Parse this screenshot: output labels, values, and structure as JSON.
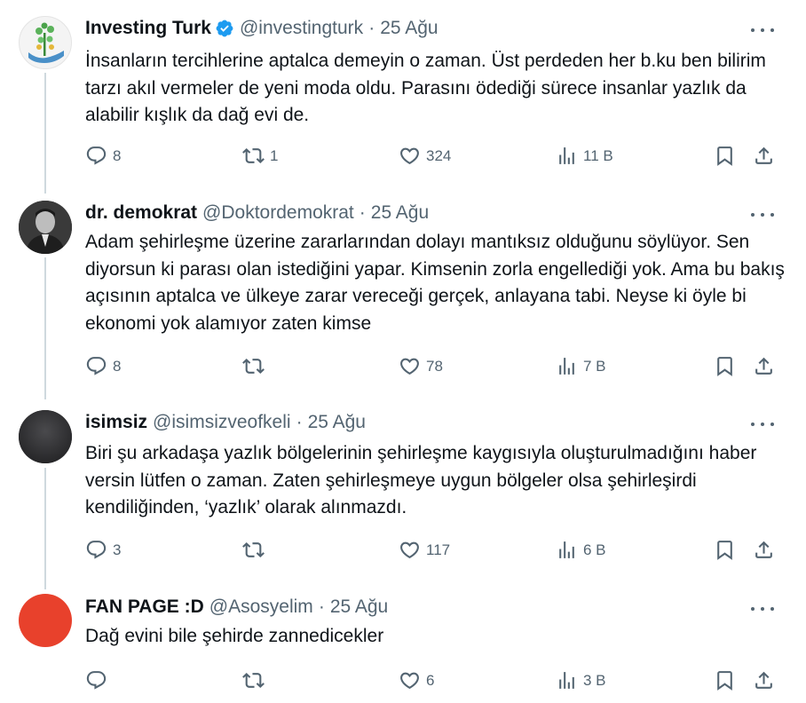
{
  "tweets": [
    {
      "name": "Investing Turk",
      "handle": "@investingturk",
      "date": "25 Ağu",
      "verified": true,
      "text": "İnsanların tercihlerine aptalca demeyin o zaman. Üst perdeden her b.ku ben bilirim tarzı akıl vermeler de yeni moda oldu. Parasını ödediği sürece insanlar yazlık da alabilir kışlık da dağ evi de.",
      "replies": "8",
      "retweets": "1",
      "likes": "324",
      "views": "11 B"
    },
    {
      "name": "dr. demokrat",
      "handle": "@Doktordemokrat",
      "date": "25 Ağu",
      "verified": false,
      "text": "Adam şehirleşme üzerine zararlarından dolayı mantıksız olduğunu söylüyor. Sen diyorsun ki parası olan istediğini yapar. Kimsenin zorla engellediği yok. Ama bu bakış açısının aptalca ve ülkeye zarar vereceği gerçek, anlayana tabi. Neyse ki öyle bi ekonomi yok alamıyor zaten kimse",
      "replies": "8",
      "retweets": "",
      "likes": "78",
      "views": "7 B"
    },
    {
      "name": "isimsiz",
      "handle": "@isimsizveofkeli",
      "date": "25 Ağu",
      "verified": false,
      "text": "Biri şu arkadaşa yazlık bölgelerinin şehirleşme kaygısıyla oluşturulmadığını haber versin lütfen o zaman. Zaten şehirleşmeye uygun bölgeler olsa şehirleşirdi kendiliğinden, ‘yazlık’ olarak alınmazdı.",
      "replies": "3",
      "retweets": "",
      "likes": "117",
      "views": "6 B"
    },
    {
      "name": "FAN PAGE :D",
      "handle": "@Asosyelim",
      "date": "25 Ağu",
      "verified": false,
      "text": "Dağ evini bile şehirde zannedicekler",
      "replies": "",
      "retweets": "",
      "likes": "6",
      "views": "3 B"
    }
  ],
  "separator": "·",
  "colors": {
    "text": "#0f1419",
    "muted": "#536471",
    "verified": "#1d9bf0",
    "thread": "#cfd9de"
  },
  "icons": [
    "reply-icon",
    "retweet-icon",
    "like-icon",
    "views-icon",
    "bookmark-icon",
    "share-icon",
    "more-icon",
    "verified-badge-icon"
  ]
}
